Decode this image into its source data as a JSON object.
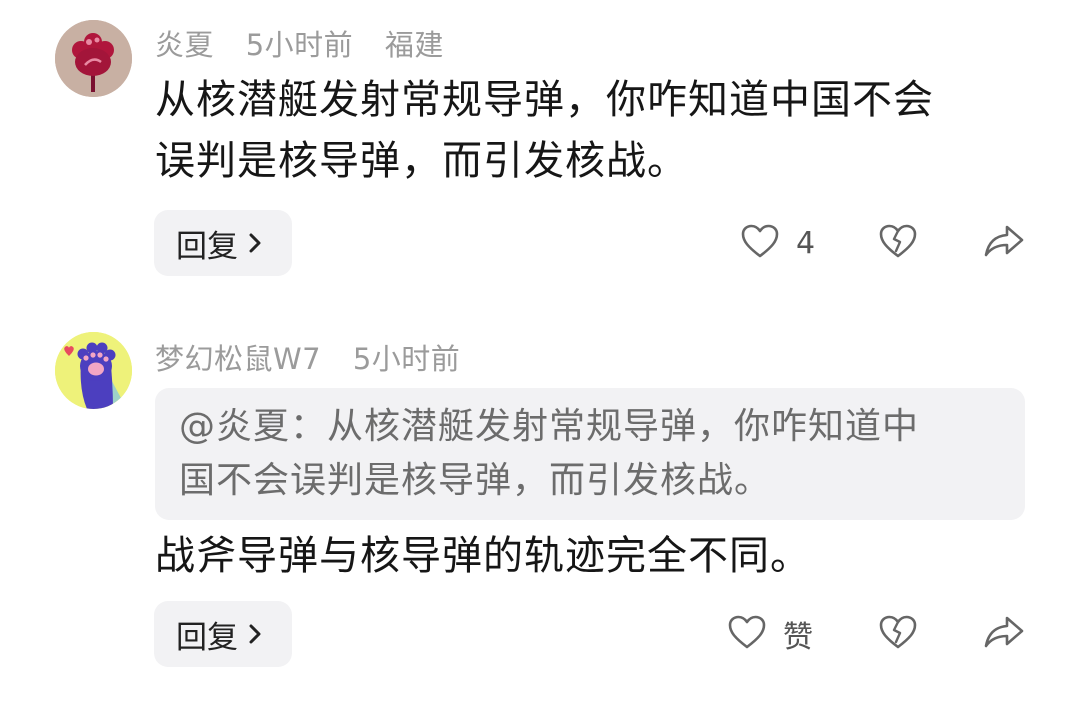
{
  "comments": [
    {
      "username": "炎夏",
      "time": "5小时前",
      "location": "福建",
      "text_line1": "从核潜艇发射常规导弹，你咋知道中国不会",
      "text_line2": "误判是核导弹，而引发核战。",
      "reply_label": "回复",
      "like_count": "4",
      "avatar_icon": "red-flower-avatar"
    },
    {
      "username": "梦幻松鼠W7",
      "time": "5小时前",
      "quote_line1": "@炎夏：从核潜艇发射常规导弹，你咋知道中",
      "quote_line2": "国不会误判是核导弹，而引发核战。",
      "text_line1": "战斧导弹与核导弹的轨迹完全不同。",
      "reply_label": "回复",
      "like_label": "赞",
      "avatar_icon": "purple-paw-avatar"
    }
  ],
  "colors": {
    "meta_gray": "#9b9b9b",
    "chip_bg": "#f2f2f4",
    "icon_gray": "#666666"
  }
}
